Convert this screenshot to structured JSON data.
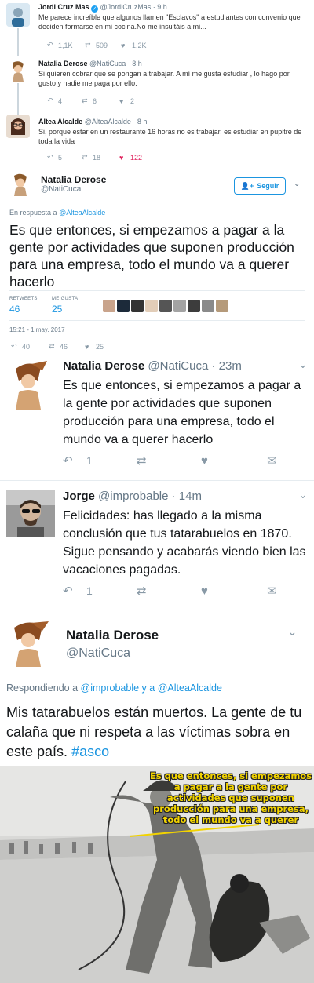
{
  "thread": [
    {
      "name": "Jordi Cruz Mas",
      "handle": "@JordiCruzMas",
      "time": "· 9 h",
      "text": "Me parece increíble que algunos llamen \"Esclavos\"  a estudiantes con convenio que deciden formarse en mi cocina.No me insultáis a mi...",
      "replies": "1,1K",
      "retweets": "509",
      "likes": "1,2K"
    },
    {
      "name": "Natalia Derose",
      "handle": "@NatiCuca",
      "time": "· 8 h",
      "text": "Si quieren cobrar que se pongan a trabajar. A mí me gusta estudiar , lo hago por gusto y nadie me paga por ello.",
      "replies": "4",
      "retweets": "6",
      "likes": "2"
    },
    {
      "name": "Altea Alcalde",
      "handle": "@AlteaAlcalde",
      "time": "· 8 h",
      "text": "Si, porque estar en un restaurante 16 horas no es trabajar, es estudiar en pupitre de toda la vida",
      "replies": "5",
      "retweets": "18",
      "likes": "122"
    }
  ],
  "focus": {
    "name": "Natalia Derose",
    "handle": "@NatiCuca",
    "follow": "Seguir",
    "reply_prefix": "En respuesta a",
    "reply_to": "@AlteaAlcalde",
    "text": "Es que entonces, si empezamos a pagar a la gente por actividades que suponen producción para una empresa, todo el mundo va a querer hacerlo",
    "retweets_label": "RETWEETS",
    "retweets": "46",
    "likes_label": "ME GUSTA",
    "likes": "25",
    "datetime": "15:21 - 1 may. 2017",
    "replies_count": "40",
    "retweets_count": "46",
    "likes_count": "25"
  },
  "mobile": [
    {
      "name": "Natalia Derose",
      "handle": "@NatiCuca",
      "time": "· 23m",
      "text": "Es que entonces, si empezamos a pagar a la gente por actividades que suponen producción para una empresa, todo el mundo va a querer hacerlo",
      "replies": "1"
    },
    {
      "name": "Jorge",
      "handle": "@improbable",
      "time": "· 14m",
      "text": "Felicidades: has llegado a la misma conclusión que tus tatarabuelos en 1870. Sigue pensando y acabarás viendo bien las vacaciones pagadas.",
      "replies": "1"
    }
  ],
  "final": {
    "name": "Natalia Derose",
    "handle": "@NatiCuca",
    "reply_prefix": "Respondiendo a",
    "reply_to_1": "@improbable",
    "reply_and": "y a",
    "reply_to_2": "@AlteaAlcalde",
    "text_main": "Mis tatarabuelos están muertos. La gente de tu calaña que ni respeta a las víctimas sobra en este país.",
    "hashtag": "#asco"
  },
  "meme": {
    "caption": "Es que entonces, si empezamos a pagar a la gente por actividades que suponen producción para una empresa, todo el mundo va a querer"
  },
  "colors": {
    "accent": "#1b95e0",
    "like_red": "#e0245e",
    "caption_yellow": "#f2d300"
  }
}
